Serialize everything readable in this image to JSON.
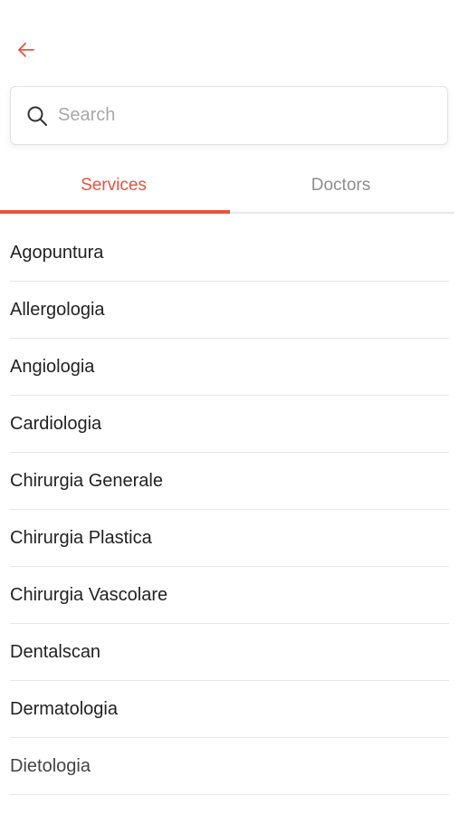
{
  "colors": {
    "accent": "#e8523f",
    "text_primary": "#222222",
    "text_muted": "#8d8d8d",
    "placeholder": "#a8a8a8",
    "divider": "#e6e6e6"
  },
  "header": {
    "back_icon": "arrow-left-icon"
  },
  "search": {
    "icon": "search-icon",
    "placeholder": "Search",
    "value": ""
  },
  "tabs": [
    {
      "label": "Services",
      "active": true
    },
    {
      "label": "Doctors",
      "active": false
    }
  ],
  "services": [
    {
      "label": "Agopuntura"
    },
    {
      "label": "Allergologia"
    },
    {
      "label": "Angiologia"
    },
    {
      "label": "Cardiologia"
    },
    {
      "label": "Chirurgia Generale"
    },
    {
      "label": "Chirurgia Plastica"
    },
    {
      "label": "Chirurgia Vascolare"
    },
    {
      "label": "Dentalscan"
    },
    {
      "label": "Dermatologia"
    },
    {
      "label": "Dietologia"
    }
  ]
}
